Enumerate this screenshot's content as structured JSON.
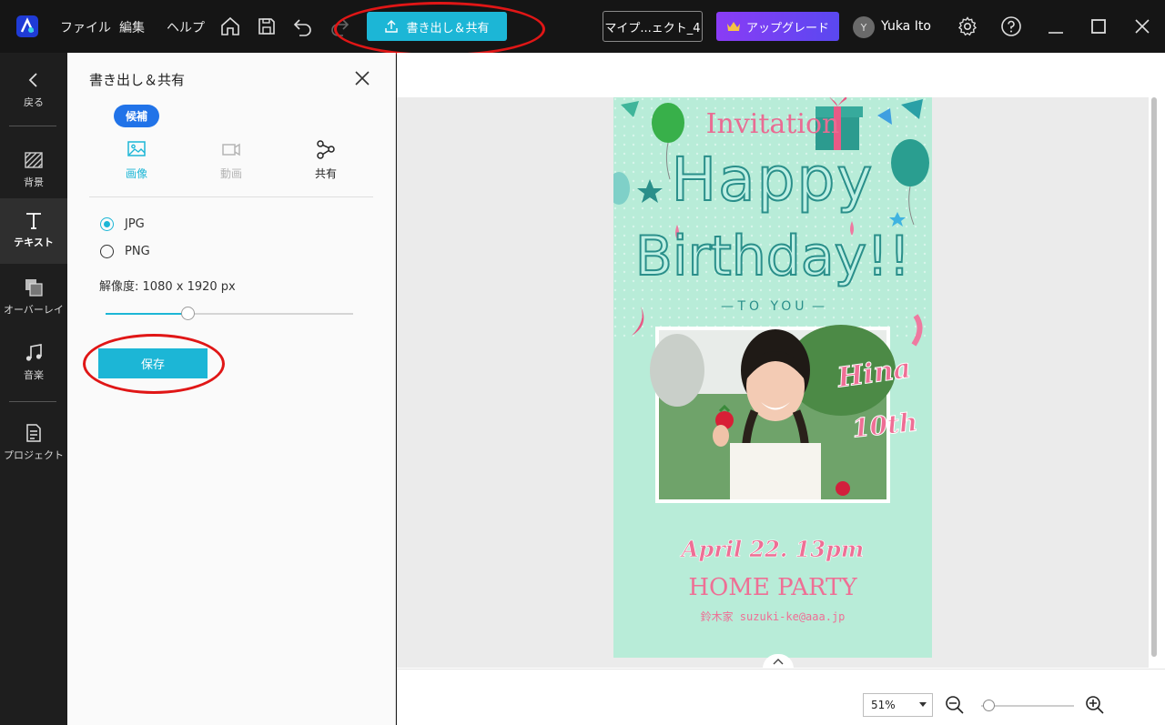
{
  "app": {
    "menu": [
      "ファイル",
      "編集",
      "ヘルプ"
    ],
    "export_label": "書き出し＆共有",
    "project_name": "マイプ...ェクト_4",
    "upgrade_label": "アップグレード",
    "user": {
      "initial": "Y",
      "name": "Yuka Ito"
    },
    "colors": {
      "accent": "#1cb6d6",
      "upgrade": "#7b3ff4",
      "annotation": "#e01616"
    }
  },
  "rail": [
    {
      "label": "戻る",
      "icon": "back-arrow-icon"
    },
    {
      "label": "背景",
      "icon": "background-icon"
    },
    {
      "label": "テキスト",
      "icon": "text-icon",
      "active": true
    },
    {
      "label": "オーバーレイ",
      "icon": "overlay-icon"
    },
    {
      "label": "音楽",
      "icon": "music-icon"
    },
    {
      "label": "プロジェクト",
      "icon": "project-icon"
    }
  ],
  "panel": {
    "title": "書き出し＆共有",
    "badge": "候補",
    "tabs": [
      {
        "label": "画像",
        "icon": "image-icon",
        "state": "active"
      },
      {
        "label": "動画",
        "icon": "video-icon",
        "state": "disabled"
      },
      {
        "label": "共有",
        "icon": "share-icon",
        "state": "normal"
      }
    ],
    "formats": [
      {
        "label": "JPG",
        "checked": true
      },
      {
        "label": "PNG",
        "checked": false
      }
    ],
    "resolution_label": "解像度:",
    "resolution_value": "1080 x 1920 px",
    "resolution_slider_fraction": 0.33,
    "save_label": "保存"
  },
  "card": {
    "invitation": "Invitation",
    "happy": "Happy",
    "birthday": "Birthday!!",
    "to_you": "TO YOU",
    "name": "Hina",
    "age": "10th",
    "date": "April 22. 13pm",
    "event": "HOME PARTY",
    "contact": "鈴木家 suzuki-ke@aaa.jp"
  },
  "zoom": {
    "value": "51%",
    "slider_fraction": 0.08
  }
}
